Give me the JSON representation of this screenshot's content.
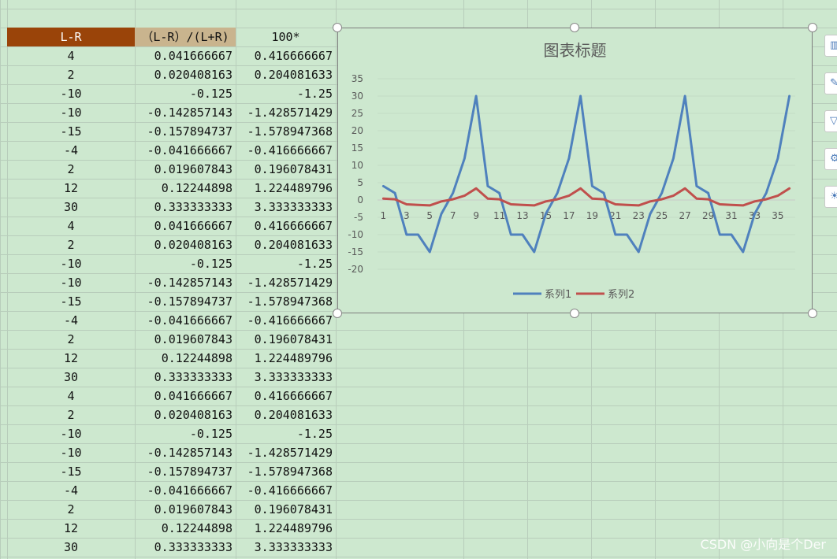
{
  "sheet": {
    "headers": [
      "L-R",
      "（L-R）/(L+R)",
      "100*"
    ],
    "header_colors": {
      "col1": "#9a4409",
      "col2": "#c9b48e"
    },
    "rows": [
      [
        "4",
        "0.041666667",
        "0.416666667"
      ],
      [
        "2",
        "0.020408163",
        "0.204081633"
      ],
      [
        "-10",
        "-0.125",
        "-1.25"
      ],
      [
        "-10",
        "-0.142857143",
        "-1.428571429"
      ],
      [
        "-15",
        "-0.157894737",
        "-1.578947368"
      ],
      [
        "-4",
        "-0.041666667",
        "-0.416666667"
      ],
      [
        "2",
        "0.019607843",
        "0.196078431"
      ],
      [
        "12",
        "0.12244898",
        "1.224489796"
      ],
      [
        "30",
        "0.333333333",
        "3.333333333"
      ],
      [
        "4",
        "0.041666667",
        "0.416666667"
      ],
      [
        "2",
        "0.020408163",
        "0.204081633"
      ],
      [
        "-10",
        "-0.125",
        "-1.25"
      ],
      [
        "-10",
        "-0.142857143",
        "-1.428571429"
      ],
      [
        "-15",
        "-0.157894737",
        "-1.578947368"
      ],
      [
        "-4",
        "-0.041666667",
        "-0.416666667"
      ],
      [
        "2",
        "0.019607843",
        "0.196078431"
      ],
      [
        "12",
        "0.12244898",
        "1.224489796"
      ],
      [
        "30",
        "0.333333333",
        "3.333333333"
      ],
      [
        "4",
        "0.041666667",
        "0.416666667"
      ],
      [
        "2",
        "0.020408163",
        "0.204081633"
      ],
      [
        "-10",
        "-0.125",
        "-1.25"
      ],
      [
        "-10",
        "-0.142857143",
        "-1.428571429"
      ],
      [
        "-15",
        "-0.157894737",
        "-1.578947368"
      ],
      [
        "-4",
        "-0.041666667",
        "-0.416666667"
      ],
      [
        "2",
        "0.019607843",
        "0.196078431"
      ],
      [
        "12",
        "0.12244898",
        "1.224489796"
      ],
      [
        "30",
        "0.333333333",
        "3.333333333"
      ]
    ]
  },
  "chart_data": {
    "type": "line",
    "title": "图表标题",
    "x": [
      1,
      2,
      3,
      4,
      5,
      6,
      7,
      8,
      9,
      10,
      11,
      12,
      13,
      14,
      15,
      16,
      17,
      18,
      19,
      20,
      21,
      22,
      23,
      24,
      25,
      26,
      27,
      28,
      29,
      30,
      31,
      32,
      33,
      34,
      35,
      36
    ],
    "x_tick_labels": [
      "1",
      "3",
      "5",
      "7",
      "9",
      "11",
      "13",
      "15",
      "17",
      "19",
      "21",
      "23",
      "25",
      "27",
      "29",
      "31",
      "33",
      "35"
    ],
    "y_ticks": [
      35,
      30,
      25,
      20,
      15,
      10,
      5,
      0,
      -5,
      -10,
      -15,
      -20
    ],
    "ylim": [
      -20,
      35
    ],
    "grid": true,
    "legend_position": "bottom",
    "series": [
      {
        "name": "系列1",
        "color": "#4f81bd",
        "values": [
          4,
          2,
          -10,
          -10,
          -15,
          -4,
          2,
          12,
          30,
          4,
          2,
          -10,
          -10,
          -15,
          -4,
          2,
          12,
          30,
          4,
          2,
          -10,
          -10,
          -15,
          -4,
          2,
          12,
          30,
          4,
          2,
          -10,
          -10,
          -15,
          -4,
          2,
          12,
          30
        ]
      },
      {
        "name": "系列2",
        "color": "#c0504d",
        "values": [
          0.416666667,
          0.204081633,
          -1.25,
          -1.428571429,
          -1.578947368,
          -0.416666667,
          0.196078431,
          1.224489796,
          3.333333333,
          0.416666667,
          0.204081633,
          -1.25,
          -1.428571429,
          -1.578947368,
          -0.416666667,
          0.196078431,
          1.224489796,
          3.333333333,
          0.416666667,
          0.204081633,
          -1.25,
          -1.428571429,
          -1.578947368,
          -0.416666667,
          0.196078431,
          1.224489796,
          3.333333333,
          0.416666667,
          0.204081633,
          -1.25,
          -1.428571429,
          -1.578947368,
          -0.416666667,
          0.196078431,
          1.224489796,
          3.333333333
        ]
      }
    ]
  },
  "side_buttons": [
    "chart-elements-icon",
    "chart-styles-icon",
    "chart-filters-icon",
    "settings-icon",
    "idea-icon"
  ],
  "watermark": "CSDN @小向是个Der"
}
